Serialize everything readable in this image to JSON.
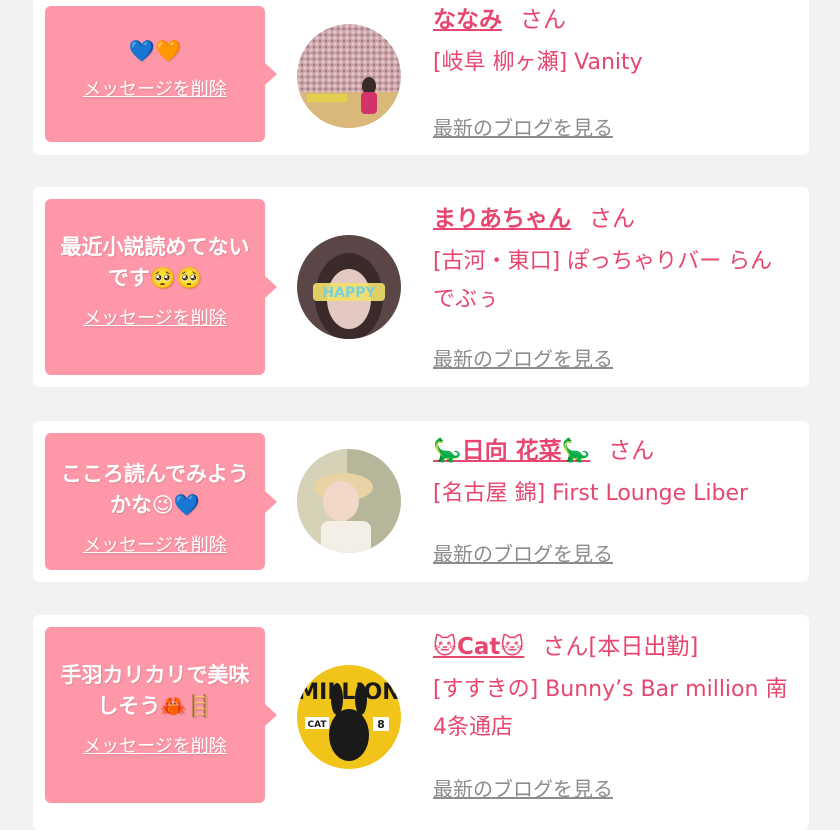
{
  "cards": [
    {
      "message": "💙🧡",
      "delete_label": "メッセージを削除",
      "name": "ななみ",
      "suffix": "さん",
      "shop": "[岐阜 柳ヶ瀬] Vanity",
      "blog_label": "最新のブログを見る"
    },
    {
      "message": "最近小説読めてないです🥺🥺",
      "delete_label": "メッセージを削除",
      "name": "まりあちゃん",
      "suffix": "さん",
      "shop": "[古河・東口] ぽっちゃりバー らんでぶぅ",
      "blog_label": "最新のブログを見る"
    },
    {
      "message": "こころ読んでみようかな😉💙",
      "delete_label": "メッセージを削除",
      "name": "🦕日向 花菜🦕",
      "suffix": "さん",
      "shop": "[名古屋 錦] First Lounge Liber",
      "blog_label": "最新のブログを見る"
    },
    {
      "message": "手羽カリカリで美味しそう🦀🪜",
      "delete_label": "メッセージを削除",
      "name": "🐱Cat🐱",
      "suffix": "さん[本日出勤]",
      "shop": "[すすきの] Bunny’s Bar million 南4条通店",
      "blog_label": "最新のブログを見る",
      "avatar_text_top": "MILLION",
      "avatar_text_left": "CAT",
      "avatar_text_right": "8"
    }
  ],
  "colors": {
    "bubble": "#fe98a8",
    "accent": "#e8466e",
    "link_gray": "#8c8c8c",
    "page_bg": "#f2f2f2"
  }
}
